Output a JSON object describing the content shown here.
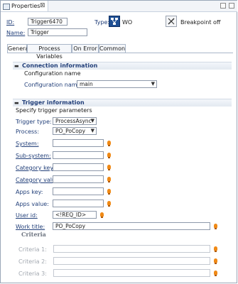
{
  "panel": {
    "tab_label": "Properties",
    "close_glyph": "⊠"
  },
  "header": {
    "id_label": "ID:",
    "id_value": "Trigger6470",
    "type_label": "Type:",
    "type_value": "WO",
    "breakpoint_label": "Breakpoint off",
    "name_label": "Name:",
    "name_value": "Trigger"
  },
  "tabs": [
    {
      "label": "General",
      "active": true
    },
    {
      "label": "Process Variables",
      "active": false
    },
    {
      "label": "On Error",
      "active": false
    },
    {
      "label": "Common",
      "active": false
    }
  ],
  "connection": {
    "title": "Connection information",
    "subtitle": "Configuration name",
    "config_label": "Configuration name:",
    "config_value": "main"
  },
  "trigger": {
    "title": "Trigger information",
    "subtitle": "Specify trigger parameters",
    "trigger_type_label": "Trigger type:",
    "trigger_type_value": "ProcessAsync",
    "process_label": "Process:",
    "process_value": "PO_PoCopy",
    "system_label": "System:",
    "system_value": "",
    "subsystem_label": "Sub-system:",
    "subsystem_value": "",
    "category_key_label": "Category key:",
    "category_key_value": "",
    "category_value_label": "Category value:",
    "category_value_value": "",
    "apps_key_label": "Apps key:",
    "apps_key_value": "",
    "apps_value_label": "Apps value:",
    "apps_value_value": "",
    "user_id_label": "User id:",
    "user_id_value": "<!REQ_ID>",
    "work_title_label": "Work title:",
    "work_title_value": "PO_PoCopy"
  },
  "criteria": {
    "title": "Criteria",
    "items": [
      {
        "label": "Criteria 1:",
        "value": ""
      },
      {
        "label": "Criteria 2:",
        "value": ""
      },
      {
        "label": "Criteria 3:",
        "value": ""
      }
    ]
  },
  "colors": {
    "accent": "#23407a",
    "indicator": "#f08a16"
  }
}
